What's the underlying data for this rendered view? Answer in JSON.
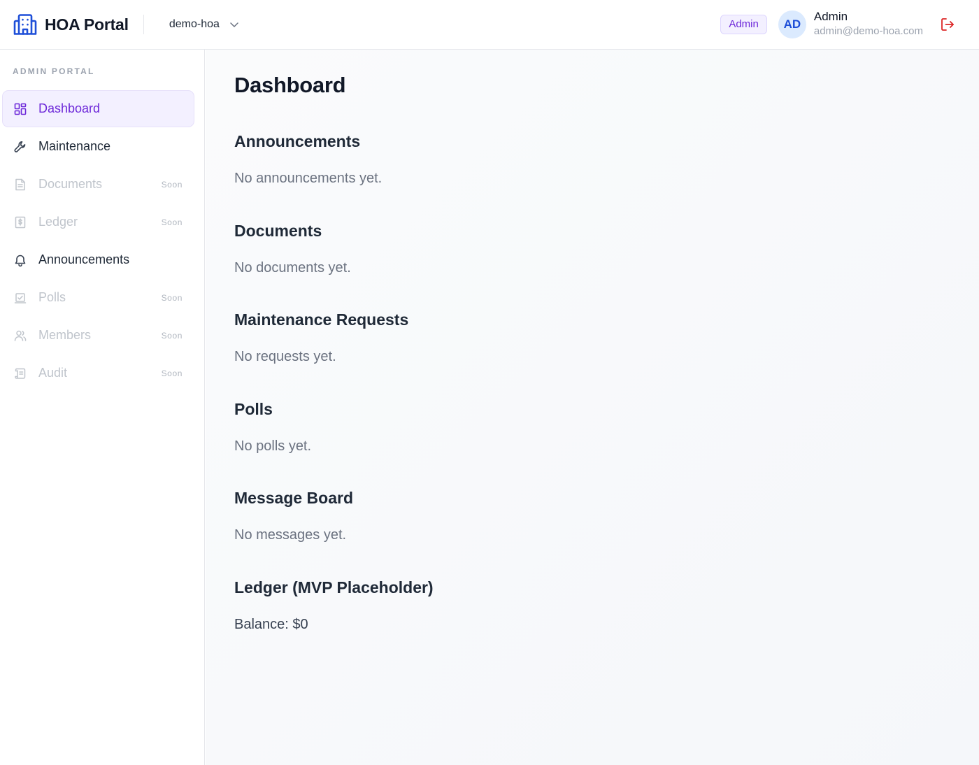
{
  "header": {
    "app_title": "HOA Portal",
    "org_name": "demo-hoa",
    "role_badge": "Admin",
    "avatar_initials": "AD",
    "user_name": "Admin",
    "user_email": "admin@demo-hoa.com"
  },
  "sidebar": {
    "heading": "ADMIN PORTAL",
    "items": [
      {
        "label": "Dashboard",
        "icon": "dashboard-grid-icon",
        "state": "active"
      },
      {
        "label": "Maintenance",
        "icon": "wrench-icon",
        "state": "enabled"
      },
      {
        "label": "Documents",
        "icon": "document-icon",
        "state": "disabled",
        "tag": "Soon"
      },
      {
        "label": "Ledger",
        "icon": "dollar-document-icon",
        "state": "disabled",
        "tag": "Soon"
      },
      {
        "label": "Announcements",
        "icon": "bell-icon",
        "state": "enabled"
      },
      {
        "label": "Polls",
        "icon": "poll-checkbox-icon",
        "state": "disabled",
        "tag": "Soon"
      },
      {
        "label": "Members",
        "icon": "users-icon",
        "state": "disabled",
        "tag": "Soon"
      },
      {
        "label": "Audit",
        "icon": "scroll-icon",
        "state": "disabled",
        "tag": "Soon"
      }
    ]
  },
  "main": {
    "title": "Dashboard",
    "sections": [
      {
        "title": "Announcements",
        "body": "No announcements yet."
      },
      {
        "title": "Documents",
        "body": "No documents yet."
      },
      {
        "title": "Maintenance Requests",
        "body": "No requests yet."
      },
      {
        "title": "Polls",
        "body": "No polls yet."
      },
      {
        "title": "Message Board",
        "body": "No messages yet."
      },
      {
        "title": "Ledger (MVP Placeholder)",
        "body": "Balance: $0"
      }
    ]
  },
  "colors": {
    "accent": "#6d28d9",
    "brand_blue": "#1d4ed8",
    "logout_red": "#dc2626",
    "active_bg": "#f3f0ff"
  }
}
